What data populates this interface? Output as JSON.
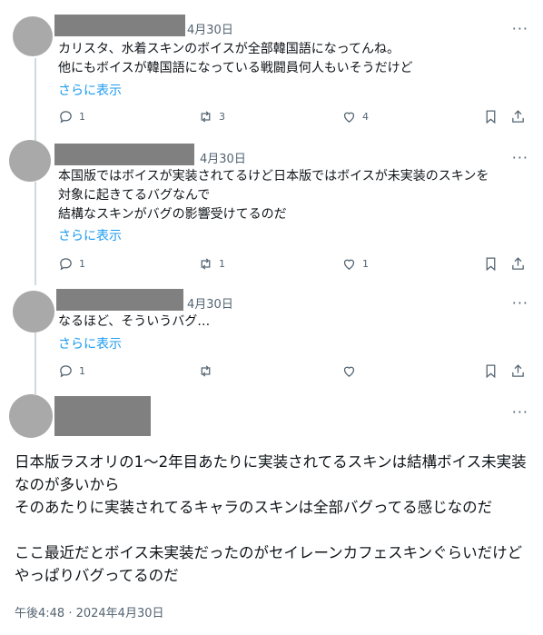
{
  "replies": [
    {
      "date": "4月30日",
      "lines": [
        "カリスタ、水着スキンのボイスが全部韓国語になってんね。",
        "他にもボイスが韓国語になっている戦闘員何人もいそうだけど"
      ],
      "show_more": "さらに表示",
      "reply_count": "1",
      "retweet_count": "3",
      "like_count": "4"
    },
    {
      "date": "4月30日",
      "lines": [
        "本国版ではボイスが実装されてるけど日本版ではボイスが未実装のスキンを",
        "対象に起きてるバグなんで",
        "結構なスキンがバグの影響受けてるのだ"
      ],
      "show_more": "さらに表示",
      "reply_count": "1",
      "retweet_count": "1",
      "like_count": "1"
    },
    {
      "date": "4月30日",
      "lines": [
        "なるほど、そういうバグ…"
      ],
      "show_more": "さらに表示",
      "reply_count": "1",
      "retweet_count": "",
      "like_count": ""
    }
  ],
  "main_post": {
    "paragraph1": "日本版ラスオリの1～2年目あたりに実装されてるスキンは結構ボイス未実装なのが多いから\nそのあたりに実装されてるキャラのスキンは全部バグってる感じなのだ",
    "paragraph2": "ここ最近だとボイス未実装だったのがセイレーンカフェスキンぐらいだけどやっぱりバグってるのだ",
    "timestamp": "午後4:48 · 2024年4月30日"
  },
  "more_label": "···",
  "colors": {
    "link": "#1d9bf0",
    "muted": "#536471",
    "avatar": "#a9a9a9",
    "redact": "#808080"
  }
}
